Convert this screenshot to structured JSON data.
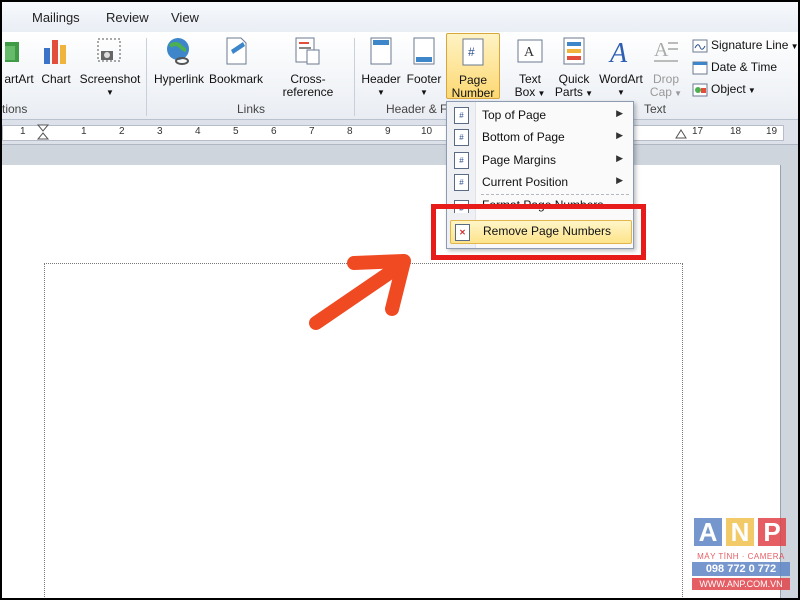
{
  "tabs": [
    "Mailings",
    "Review",
    "View"
  ],
  "ribbon": {
    "illustrations": {
      "smartart": "artArt",
      "chart": "Chart",
      "screenshot": "Screenshot",
      "group_label": "tions"
    },
    "links": {
      "hyperlink": "Hyperlink",
      "bookmark": "Bookmark",
      "cross_reference": "Cross-reference",
      "group_label": "Links"
    },
    "header_footer": {
      "header": "Header",
      "footer": "Footer",
      "page_number_line1": "Page",
      "page_number_line2": "Number",
      "group_label": "Header & F"
    },
    "text": {
      "text_box_line1": "Text",
      "text_box_line2": "Box",
      "quick_parts_line1": "Quick",
      "quick_parts_line2": "Parts",
      "wordart": "WordArt",
      "drop_cap_line1": "Drop",
      "drop_cap_line2": "Cap",
      "signature_line": "Signature Line",
      "date_time": "Date & Time",
      "object": "Object",
      "group_label": "Text"
    }
  },
  "ruler": {
    "numbers": [
      "1",
      "1",
      "2",
      "3",
      "4",
      "5",
      "6",
      "7",
      "8",
      "9",
      "10",
      "17",
      "18",
      "19"
    ]
  },
  "menu": {
    "items": [
      {
        "label": "Top of Page",
        "icon": "page-top-icon"
      },
      {
        "label": "Bottom of Page",
        "icon": "page-bottom-icon"
      },
      {
        "label": "Page Margins",
        "icon": "page-margins-icon"
      },
      {
        "label": "Current Position",
        "icon": "current-position-icon"
      },
      {
        "label": "Format Page Numbers...",
        "icon": "format-page-numbers-icon"
      },
      {
        "label": "Remove Page Numbers",
        "icon": "remove-page-numbers-icon"
      }
    ]
  },
  "logo": {
    "a": "A",
    "n": "N",
    "p": "P",
    "line1": "MÁY TÍNH · CAMERA",
    "phone": "098 772 0 772",
    "website": "WWW.ANP.COM.VN"
  },
  "colors": {
    "highlight_red": "#e81b1b",
    "arrow_orange": "#f04a22",
    "logo_blue": "#5f86c6",
    "logo_red": "#e0434a",
    "logo_yellow": "#f2c14e"
  }
}
